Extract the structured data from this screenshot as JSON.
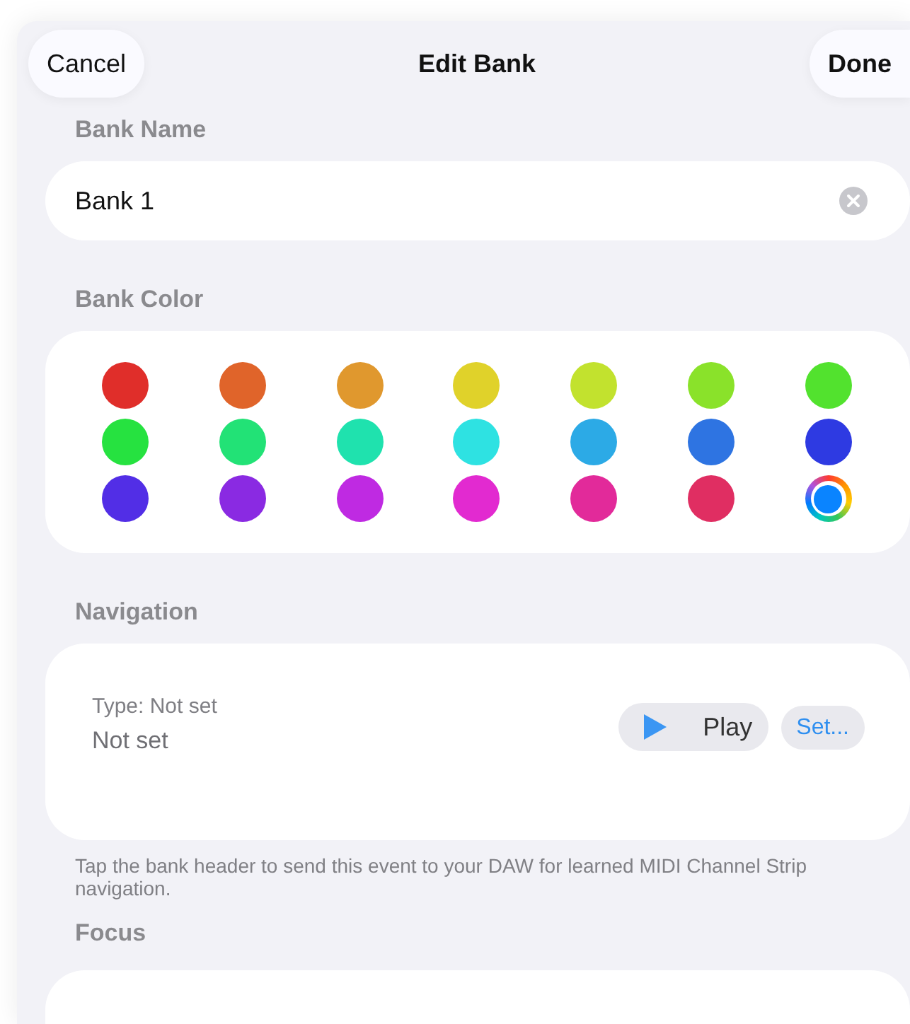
{
  "header": {
    "cancel": "Cancel",
    "title": "Edit Bank",
    "done": "Done"
  },
  "bank_name": {
    "label": "Bank Name",
    "value": "Bank 1"
  },
  "bank_color": {
    "label": "Bank Color",
    "swatches": [
      {
        "kind": "solid",
        "color": "#e02e2a",
        "selected": false
      },
      {
        "kind": "solid",
        "color": "#e0642a",
        "selected": false
      },
      {
        "kind": "solid",
        "color": "#e0982e",
        "selected": false
      },
      {
        "kind": "solid",
        "color": "#e0d22a",
        "selected": false
      },
      {
        "kind": "solid",
        "color": "#c2e22e",
        "selected": false
      },
      {
        "kind": "solid",
        "color": "#8ae22a",
        "selected": false
      },
      {
        "kind": "solid",
        "color": "#52e22e",
        "selected": false
      },
      {
        "kind": "solid",
        "color": "#26e240",
        "selected": false
      },
      {
        "kind": "solid",
        "color": "#22e276",
        "selected": false
      },
      {
        "kind": "solid",
        "color": "#1fe2ae",
        "selected": false
      },
      {
        "kind": "solid",
        "color": "#2ee2e2",
        "selected": false
      },
      {
        "kind": "solid",
        "color": "#2caae6",
        "selected": false
      },
      {
        "kind": "solid",
        "color": "#2e74e2",
        "selected": false
      },
      {
        "kind": "solid",
        "color": "#2e3ae2",
        "selected": false
      },
      {
        "kind": "solid",
        "color": "#522ee6",
        "selected": false
      },
      {
        "kind": "solid",
        "color": "#8a2ae2",
        "selected": false
      },
      {
        "kind": "solid",
        "color": "#bf2ae2",
        "selected": false
      },
      {
        "kind": "solid",
        "color": "#e22ad0",
        "selected": false
      },
      {
        "kind": "solid",
        "color": "#e22a9a",
        "selected": false
      },
      {
        "kind": "solid",
        "color": "#e02e62",
        "selected": false
      },
      {
        "kind": "custom",
        "color": "#0a84ff",
        "selected": true
      }
    ]
  },
  "navigation": {
    "label": "Navigation",
    "type": "Type: Not set",
    "value": "Not set",
    "play": "Play",
    "set": "Set...",
    "footnote": "Tap the bank header to send this event to your DAW for learned MIDI Channel Strip navigation."
  },
  "focus": {
    "label": "Focus"
  }
}
